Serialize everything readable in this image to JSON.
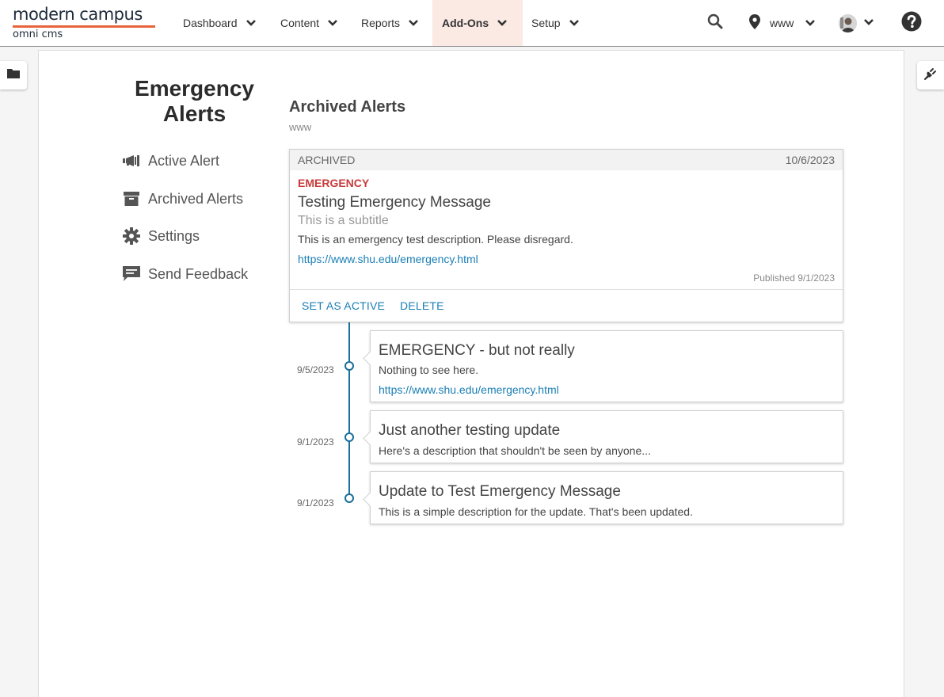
{
  "header": {
    "logo_main": "modern campus",
    "logo_sub": "omni cms",
    "nav": [
      {
        "label": "Dashboard"
      },
      {
        "label": "Content"
      },
      {
        "label": "Reports"
      },
      {
        "label": "Add-Ons",
        "active": true
      },
      {
        "label": "Setup"
      }
    ],
    "site_label": "www",
    "icons": [
      "search-icon",
      "map-pin-icon",
      "avatar",
      "help-icon"
    ]
  },
  "sidebar": {
    "title": "Emergency Alerts",
    "items": [
      {
        "label": "Active Alert",
        "icon": "megaphone-icon"
      },
      {
        "label": "Archived Alerts",
        "icon": "archive-box-icon"
      },
      {
        "label": "Settings",
        "icon": "gear-icon"
      },
      {
        "label": "Send Feedback",
        "icon": "comment-icon"
      }
    ]
  },
  "main": {
    "title": "Archived Alerts",
    "subtitle": "www",
    "card": {
      "status": "ARCHIVED",
      "date": "10/6/2023",
      "type": "EMERGENCY",
      "title": "Testing Emergency Message",
      "subtitle": "This is a subtitle",
      "description": "This is an emergency test description. Please disregard.",
      "link": "https://www.shu.edu/emergency.html",
      "published": "Published 9/1/2023",
      "actions": {
        "set_active": "SET AS ACTIVE",
        "delete": "DELETE"
      }
    },
    "updates": [
      {
        "date": "9/5/2023",
        "title": "EMERGENCY - but not really",
        "description": "Nothing to see here.",
        "link": "https://www.shu.edu/emergency.html"
      },
      {
        "date": "9/1/2023",
        "title": "Just another testing update",
        "description": "Here's a description that shouldn't be seen by anyone..."
      },
      {
        "date": "9/1/2023",
        "title": "Update to Test Emergency Message",
        "description": "This is a simple description for the update. That's been updated."
      }
    ]
  },
  "colors": {
    "accent": "#e8643c",
    "link": "#1a7fb5",
    "emergency": "#c83b3b",
    "active_nav_bg": "#fbe9e4",
    "timeline": "#1a6e9a"
  }
}
